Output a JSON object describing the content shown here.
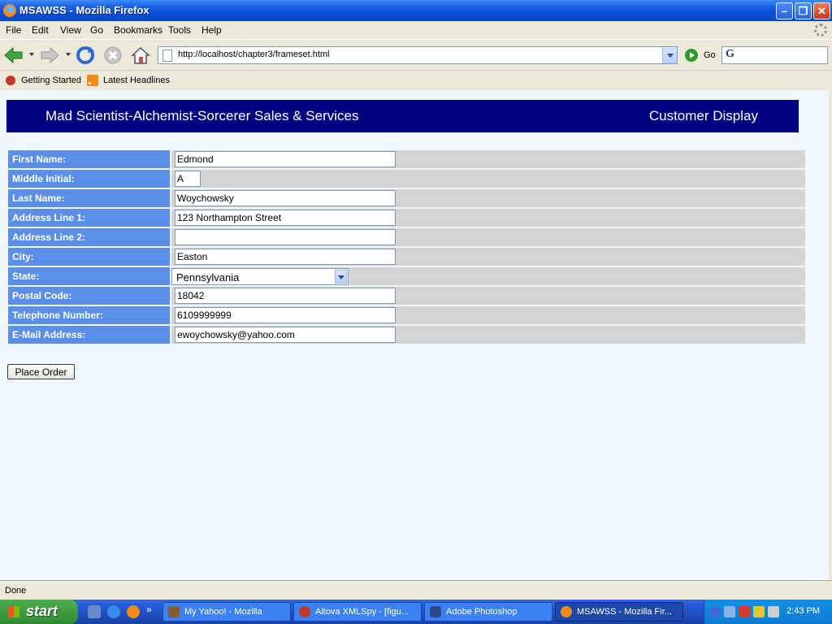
{
  "window": {
    "title": "MSAWSS - Mozilla Firefox"
  },
  "menu": {
    "items": [
      "File",
      "Edit",
      "View",
      "Go",
      "Bookmarks",
      "Tools",
      "Help"
    ]
  },
  "nav": {
    "url": "http://localhost/chapter3/frameset.html",
    "go_label": "Go",
    "search_logo": "G"
  },
  "bookmarks": {
    "items": [
      "Getting Started",
      "Latest Headlines"
    ]
  },
  "banner": {
    "left": "Mad Scientist-Alchemist-Sorcerer Sales & Services",
    "right": "Customer Display"
  },
  "form": {
    "first_name": {
      "label": "First Name:",
      "value": "Edmond"
    },
    "middle_initial": {
      "label": "Middle Initial:",
      "value": "A"
    },
    "last_name": {
      "label": "Last Name:",
      "value": "Woychowsky"
    },
    "address1": {
      "label": "Address Line 1:",
      "value": "123 Northampton Street"
    },
    "address2": {
      "label": "Address Line 2:",
      "value": ""
    },
    "city": {
      "label": "City:",
      "value": "Easton"
    },
    "state": {
      "label": "State:",
      "value": "Pennsylvania"
    },
    "postal": {
      "label": "Postal Code:",
      "value": "18042"
    },
    "phone": {
      "label": "Telephone Number:",
      "value": "6109999999"
    },
    "email": {
      "label": "E-Mail Address:",
      "value": "ewoychowsky@yahoo.com"
    },
    "submit_label": "Place Order"
  },
  "status": {
    "text": "Done"
  },
  "taskbar": {
    "start_label": "start",
    "chevron": "»",
    "tasks": [
      "My Yahoo! - Mozilla",
      "Altova XMLSpy - [figu...",
      "Adobe Photoshop",
      "MSAWSS - Mozilla Fir..."
    ],
    "clock": "2:43 PM"
  },
  "colors": {
    "banner": "#000080",
    "label_bg": "#5b8fe8",
    "field_bg": "#d4d4d4",
    "content_bg": "#f0f6fe"
  },
  "icons": [
    "firefox-icon",
    "back-arrow-icon",
    "forward-arrow-icon",
    "reload-icon",
    "stop-icon",
    "home-icon",
    "page-icon",
    "go-icon",
    "google-icon",
    "bookmark-icon",
    "rss-icon",
    "windows-flag-icon"
  ]
}
